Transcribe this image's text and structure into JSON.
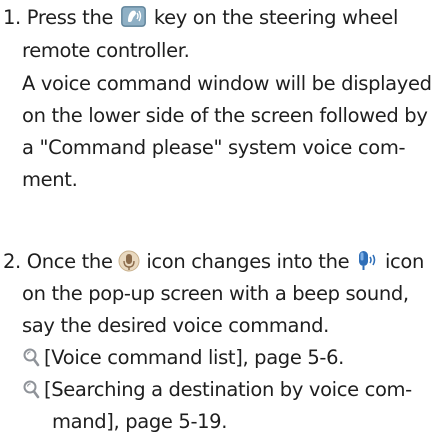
{
  "steps": [
    {
      "number": "1.",
      "line1_before": "Press the",
      "line1_after": "key on the steering wheel",
      "lines": [
        "remote controller.",
        "A voice command window will be displayed",
        "on the lower side of the screen followed by",
        "a \"Command please\" system voice com-",
        "ment."
      ]
    },
    {
      "number": "2.",
      "line1_a": "Once the",
      "line1_b": "icon changes into the",
      "line1_c": "icon",
      "lines": [
        "on the pop-up screen with a beep sound,",
        "say the desired voice command."
      ],
      "references": [
        {
          "text": "[Voice command list], page 5-6."
        },
        {
          "text": "[Searching a destination by voice com-",
          "continuation": "mand], page 5-19."
        }
      ]
    }
  ],
  "icons": {
    "voice_key": "voice-key-icon",
    "mic_idle": "microphone-idle-icon",
    "mic_active": "microphone-active-icon",
    "reference": "reference-magnifier-icon"
  },
  "colors": {
    "text": "#1e1e1e",
    "key_background": "#7f9fb4",
    "mic_active_blue": "#2f6fb8",
    "mic_idle_brown": "#8a6a4a",
    "reference_gray": "#8f9399"
  }
}
